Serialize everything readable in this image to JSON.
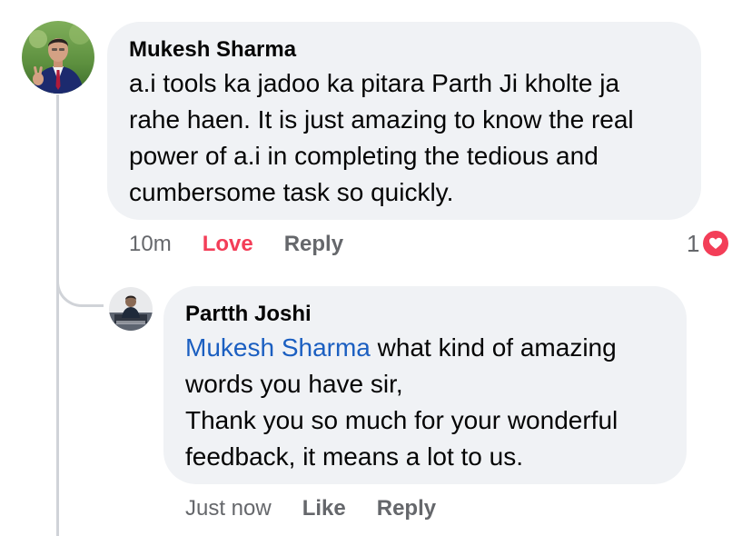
{
  "comment": {
    "author": "Mukesh Sharma",
    "lines": [
      "a.i tools ka jadoo ka pitara Parth Ji kholte ja",
      "rahe haen. It is just amazing to know the real",
      "power of a.i in completing the tedious and",
      "cumbersome task so quickly."
    ],
    "time": "10m",
    "reaction_label": "Love",
    "reply_label": "Reply",
    "reaction_count": "1",
    "reaction_icon": "heart-icon",
    "colors": {
      "love": "#f33e58",
      "bubble": "#f0f2f5",
      "meta": "#65676b"
    }
  },
  "reply": {
    "author": "Partth Joshi",
    "mention": "Mukesh Sharma",
    "line1_rest": " what kind of amazing",
    "lines": [
      "words you have sir,",
      "Thank you so much for your wonderful",
      "feedback, it means a lot to us."
    ],
    "time": "Just now",
    "like_label": "Like",
    "reply_label": "Reply",
    "colors": {
      "mention": "#1b5fc1"
    }
  }
}
